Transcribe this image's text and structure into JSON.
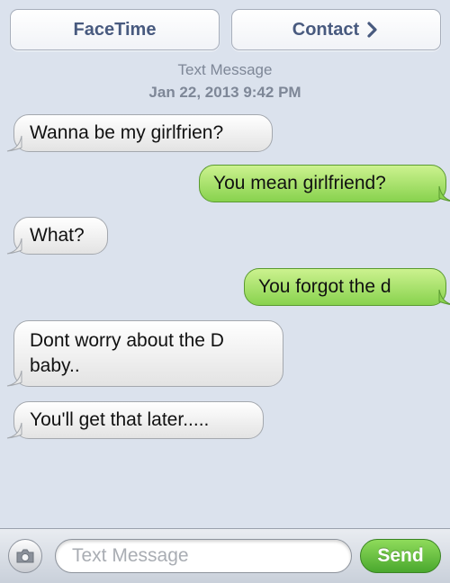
{
  "header": {
    "facetime_label": "FaceTime",
    "contact_label": "Contact"
  },
  "timestamp": {
    "label": "Text Message",
    "date": "Jan 22, 2013 9:42 PM"
  },
  "messages": [
    {
      "direction": "received",
      "text": "Wanna be my girlfrien?"
    },
    {
      "direction": "sent",
      "text": "You mean girlfriend?"
    },
    {
      "direction": "received",
      "text": "What?"
    },
    {
      "direction": "sent",
      "text": "You forgot the d"
    },
    {
      "direction": "received",
      "text": "Dont worry about the D baby.."
    },
    {
      "direction": "received",
      "text": "You'll get that later....."
    }
  ],
  "composer": {
    "placeholder": "Text Message",
    "send_label": "Send",
    "camera_icon": "camera-icon"
  },
  "colors": {
    "background": "#dbe2ed",
    "sent_bubble": "#9fe066",
    "received_bubble": "#f2f2f2",
    "header_text": "#485a7f",
    "send_button": "#5cb83a"
  }
}
